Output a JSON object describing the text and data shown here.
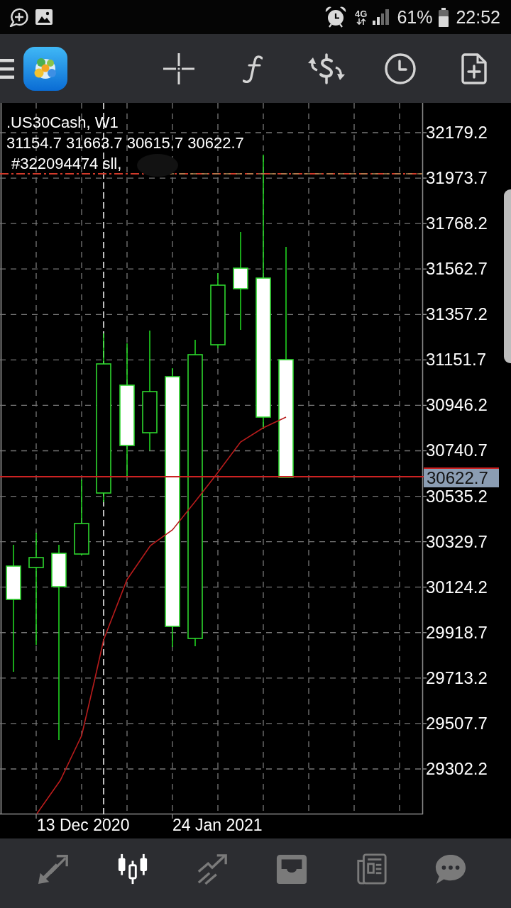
{
  "status_bar": {
    "network": "4G",
    "battery": "61%",
    "time": "22:52"
  },
  "chart": {
    "symbol": ".US30Cash, W1",
    "ohlc": "31154.7 31663.7 30615.7 30622.7",
    "order": "#322094474 sll,",
    "price_labels": [
      "32179.2",
      "31973.7",
      "31768.2",
      "31562.7",
      "31357.2",
      "31151.7",
      "30946.2",
      "30740.7",
      "30535.2",
      "30329.7",
      "30124.2",
      "29918.7",
      "29713.2",
      "29507.7",
      "29302.2"
    ],
    "current_price": "30622.7",
    "date_labels": [
      "13 Dec 2020",
      "24 Jan 2021"
    ]
  },
  "bottom_nav": {
    "tabs": [
      {
        "kind": "arrows",
        "selected": false
      },
      {
        "kind": "candles",
        "selected": true
      },
      {
        "kind": "trendlines",
        "selected": false
      },
      {
        "kind": "tray",
        "selected": false
      },
      {
        "kind": "newspaper",
        "selected": false
      },
      {
        "kind": "chat",
        "selected": false
      }
    ]
  }
}
